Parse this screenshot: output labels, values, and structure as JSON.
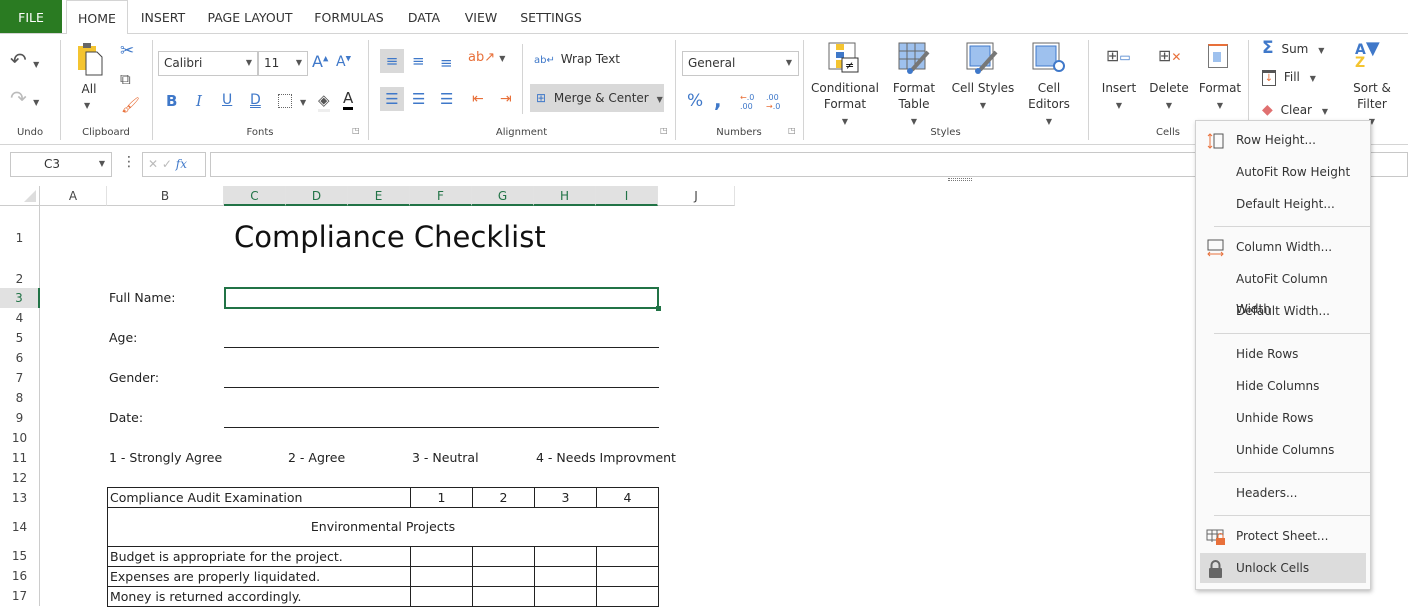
{
  "tabs": [
    "FILE",
    "HOME",
    "INSERT",
    "PAGE LAYOUT",
    "FORMULAS",
    "DATA",
    "VIEW",
    "SETTINGS"
  ],
  "active_tab": "HOME",
  "colors": {
    "file_tab": "#2a7b22",
    "accent": "#217346",
    "icon_blue": "#3f78c9",
    "icon_orange": "#e8703a"
  },
  "ribbon": {
    "groups": {
      "undo": "Undo",
      "clipboard": "Clipboard",
      "fonts": "Fonts",
      "alignment": "Alignment",
      "numbers": "Numbers",
      "styles": "Styles",
      "cells": "Cells"
    },
    "paste_label": "All",
    "font_name": "Calibri",
    "font_size": "11",
    "bold": "B",
    "italic": "I",
    "underline": "U",
    "double_underline": "D",
    "wrap_text": "Wrap Text",
    "merge_center": "Merge & Center",
    "number_format": "General",
    "conditional_format": [
      "Conditional",
      "Format"
    ],
    "format_table": [
      "Format",
      "Table"
    ],
    "cell_styles": "Cell Styles",
    "cell_editors": [
      "Cell",
      "Editors"
    ],
    "insert": "Insert",
    "delete": "Delete",
    "format": "Format",
    "sum": "Sum",
    "fill": "Fill",
    "clear": "Clear",
    "sort_filter": [
      "Sort &",
      "Filter"
    ]
  },
  "formula_bar": {
    "name_box": "C3",
    "formula": "",
    "fx": "fx"
  },
  "columns": [
    "A",
    "B",
    "C",
    "D",
    "E",
    "F",
    "G",
    "H",
    "I",
    "J"
  ],
  "selected_columns": [
    "C",
    "D",
    "E",
    "F",
    "G",
    "H",
    "I"
  ],
  "rows": [
    "1",
    "2",
    "3",
    "4",
    "5",
    "6",
    "7",
    "8",
    "9",
    "10",
    "11",
    "12",
    "13",
    "14",
    "15",
    "16",
    "17"
  ],
  "selected_row": "3",
  "sheet": {
    "title": "Compliance Checklist",
    "fields": [
      "Full Name:",
      "Age:",
      "Gender:",
      "Date:"
    ],
    "scale": [
      "1 - Strongly Agree",
      "2 - Agree",
      "3 - Neutral",
      "4 - Needs Improvment"
    ],
    "table_header": [
      "Compliance Audit Examination",
      "1",
      "2",
      "3",
      "4"
    ],
    "section": "Environmental Projects",
    "items": [
      "Budget is appropriate for the project.",
      "Expenses are properly liquidated.",
      "Money is returned accordingly."
    ]
  },
  "format_menu": {
    "items": [
      {
        "label": "Row Height...",
        "icon": "row-height-icon"
      },
      {
        "label": "AutoFit Row Height"
      },
      {
        "label": "Default Height..."
      },
      {
        "label": "Column Width...",
        "icon": "column-width-icon"
      },
      {
        "label": "AutoFit Column Width"
      },
      {
        "label": "Default Width..."
      },
      {
        "label": "Hide Rows"
      },
      {
        "label": "Hide Columns"
      },
      {
        "label": "Unhide Rows"
      },
      {
        "label": "Unhide Columns"
      },
      {
        "label": "Headers..."
      },
      {
        "label": "Protect Sheet...",
        "icon": "protect-sheet-icon"
      },
      {
        "label": "Unlock Cells",
        "icon": "lock-icon",
        "highlighted": true
      }
    ]
  }
}
